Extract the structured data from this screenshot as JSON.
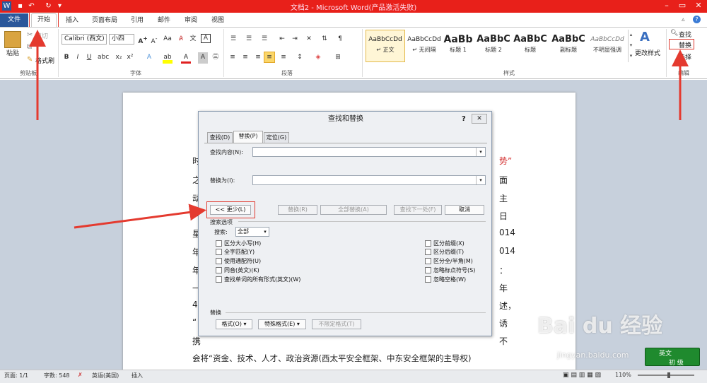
{
  "window": {
    "title": "文档2 - Microsoft Word(产品激活失败)"
  },
  "tabs": [
    "文件",
    "开始",
    "插入",
    "页面布局",
    "引用",
    "邮件",
    "审阅",
    "视图"
  ],
  "clipboard": {
    "paste": "粘贴",
    "cut": "剪切",
    "copy": "复制",
    "format_painter": "格式刷",
    "group": "剪贴板"
  },
  "font": {
    "name": "Calibri (西文)",
    "size": "小四",
    "group": "字体"
  },
  "paragraph": {
    "group": "段落"
  },
  "styles": {
    "items": [
      {
        "preview": "AaBbCcDd",
        "name": "↵ 正文"
      },
      {
        "preview": "AaBbCcDd",
        "name": "↵ 无间隔"
      },
      {
        "preview": "AaBb",
        "name": "标题 1"
      },
      {
        "preview": "AaBbC",
        "name": "标题 2"
      },
      {
        "preview": "AaBbC",
        "name": "标题"
      },
      {
        "preview": "AaBbC",
        "name": "副标题"
      },
      {
        "preview": "AaBbCcDd",
        "name": "不明显强调"
      }
    ],
    "change": "更改样式",
    "group": "样式"
  },
  "editing": {
    "find": "查找",
    "replace": "替换",
    "select": "选择",
    "group": "编辑"
  },
  "document": {
    "left_chars": [
      "时",
      "之",
      "动",
      "一",
      "星",
      "年",
      "年",
      "一",
      "4",
      "“",
      "携"
    ],
    "right_chars": [
      "势”",
      "面",
      "主",
      "日",
      "014",
      "014",
      "：",
      "年",
      "述，",
      "诱",
      "不"
    ],
    "last_line": "会将“资金、技术、人才、政治资源(西太平安全框架、中东安全框架的主导权)"
  },
  "dialog": {
    "title": "查找和替换",
    "help": "?",
    "tabs": [
      "查找(D)",
      "替换(P)",
      "定位(G)"
    ],
    "find_label": "查找内容(N):",
    "replace_label": "替换为(I):",
    "buttons": {
      "less": "<< 更少(L)",
      "replace": "替换(R)",
      "replace_all": "全部替换(A)",
      "find_next": "查找下一处(F)",
      "cancel": "取消"
    },
    "search_options_label": "搜索选项",
    "search_label": "搜索:",
    "search_value": "全部",
    "left_options": [
      "区分大小写(H)",
      "全字匹配(Y)",
      "使用通配符(U)",
      "同音(英文)(K)",
      "查找单词的所有形式(英文)(W)"
    ],
    "right_options": [
      "区分前缀(X)",
      "区分后缀(T)",
      "区分全/半角(M)",
      "忽略标点符号(S)",
      "忽略空格(W)"
    ],
    "replace_section": "替换",
    "format_btn": "格式(O) ▾",
    "special_btn": "特殊格式(E) ▾",
    "noformat_btn": "不限定格式(T)"
  },
  "status": {
    "page": "页面: 1/1",
    "words": "字数: 548",
    "language": "英语(美国)",
    "mode": "插入",
    "zoom": "110%"
  },
  "watermark": {
    "brand": "Bai du 经验",
    "url": "jingyan.baidu.com"
  },
  "ime": {
    "lang": "英文",
    "mode": "初 级"
  },
  "colors": {
    "title_bar": "#e8201a",
    "file_tab": "#2b579a",
    "arrow": "#e43a2f",
    "highlight_box": "#e03a2f"
  }
}
